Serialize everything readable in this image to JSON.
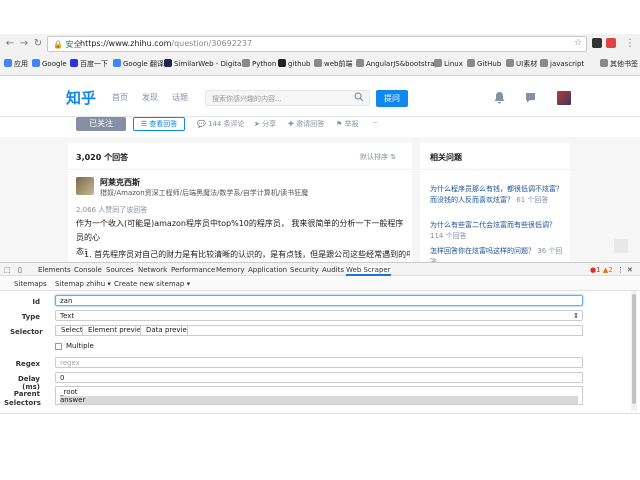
{
  "browser": {
    "secure_label": "安全",
    "url_host": "https://www.zhihu.com",
    "url_path": "/question/30692237",
    "bookmarks": [
      {
        "label": "应用",
        "icon": "apps-icon",
        "color": "#4285f4"
      },
      {
        "label": "Google",
        "icon": "google-icon",
        "color": "#4285f4"
      },
      {
        "label": "百度一下",
        "icon": "baidu-icon",
        "color": "#2932e1"
      },
      {
        "label": "Google 翻译",
        "icon": "translate-icon",
        "color": "#4285f4"
      },
      {
        "label": "SimilarWeb - Digital...",
        "icon": "similarweb-icon",
        "color": "#1b2653"
      },
      {
        "label": "Python",
        "icon": "folder-icon",
        "color": "#8a8a8a"
      },
      {
        "label": "github",
        "icon": "github-icon",
        "color": "#222222"
      },
      {
        "label": "web前端",
        "icon": "folder-icon",
        "color": "#8a8a8a"
      },
      {
        "label": "AngularJS&bootstrap",
        "icon": "folder-icon",
        "color": "#8a8a8a"
      },
      {
        "label": "Linux",
        "icon": "folder-icon",
        "color": "#8a8a8a"
      },
      {
        "label": "GitHub",
        "icon": "folder-icon",
        "color": "#8a8a8a"
      },
      {
        "label": "UI素材",
        "icon": "folder-icon",
        "color": "#8a8a8a"
      },
      {
        "label": "javascript",
        "icon": "folder-icon",
        "color": "#8a8a8a"
      },
      {
        "label": "其他书签",
        "icon": "folder-icon",
        "color": "#8a8a8a"
      }
    ]
  },
  "zhihu": {
    "logo": "知乎",
    "nav": [
      "首页",
      "发现",
      "话题"
    ],
    "search_placeholder": "搜索你感兴趣的内容...",
    "ask_label": "提问",
    "brand_color": "#0f88eb"
  },
  "question_actions": {
    "followed": "已关注",
    "view_answers": "查看回答",
    "comments": "144 条评论",
    "share": "分享",
    "invite": "邀请回答",
    "report": "举报",
    "more": "···"
  },
  "answers": {
    "count_label": "3,020 个回答",
    "sort_label": "默认排序",
    "author_name": "阿莱克西斯",
    "author_bio": "猎奴/Amazon资深工程师/后端黑魔法/数学系/自学计算机/读书狂魔",
    "agree_label": "2,066 人赞同了该回答",
    "text_line1": "作为一个收入(可能是)amazon程序员中top%10的程序员，  我来很简单的分析一下一般程序员的心",
    "text_line2": "态：",
    "list_item": "1. 首先程序员对自己的财力是有比较清晰的认识的，是有点钱，但是跟公司这些经常遇到的中层"
  },
  "related": {
    "title": "相关问题",
    "items": [
      {
        "q": "为什么程序员那么有钱，都很低调不炫富？而没钱的人反而喜欢炫富？",
        "c": "61 个回答"
      },
      {
        "q": "为什么有些富二代会炫富而有些很低调？",
        "c": "114 个回答"
      },
      {
        "q": "怎样回答你在炫富吗这样的问题？",
        "c": "36 个回答"
      }
    ]
  },
  "devtools": {
    "tabs": [
      "Elements",
      "Console",
      "Sources",
      "Network",
      "Performance",
      "Memory",
      "Application",
      "Security",
      "Audits",
      "Web Scraper"
    ],
    "errors": "1",
    "warnings": "2"
  },
  "scraper": {
    "menu": [
      "Sitemaps",
      "Sitemap zhihu ▾",
      "Create new sitemap ▾"
    ],
    "id_label": "Id",
    "id_value": "zan",
    "type_label": "Type",
    "type_value": "Text",
    "selector_label": "Selector",
    "selector_buttons": [
      "Select",
      "Element preview",
      "Data preview"
    ],
    "multiple_label": "Multiple",
    "regex_label": "Regex",
    "regex_placeholder": "regex",
    "delay_label": "Delay (ms)",
    "delay_value": "0",
    "parent_label_1": "Parent",
    "parent_label_2": "Selectors",
    "parents": [
      "_root",
      "answer"
    ]
  }
}
